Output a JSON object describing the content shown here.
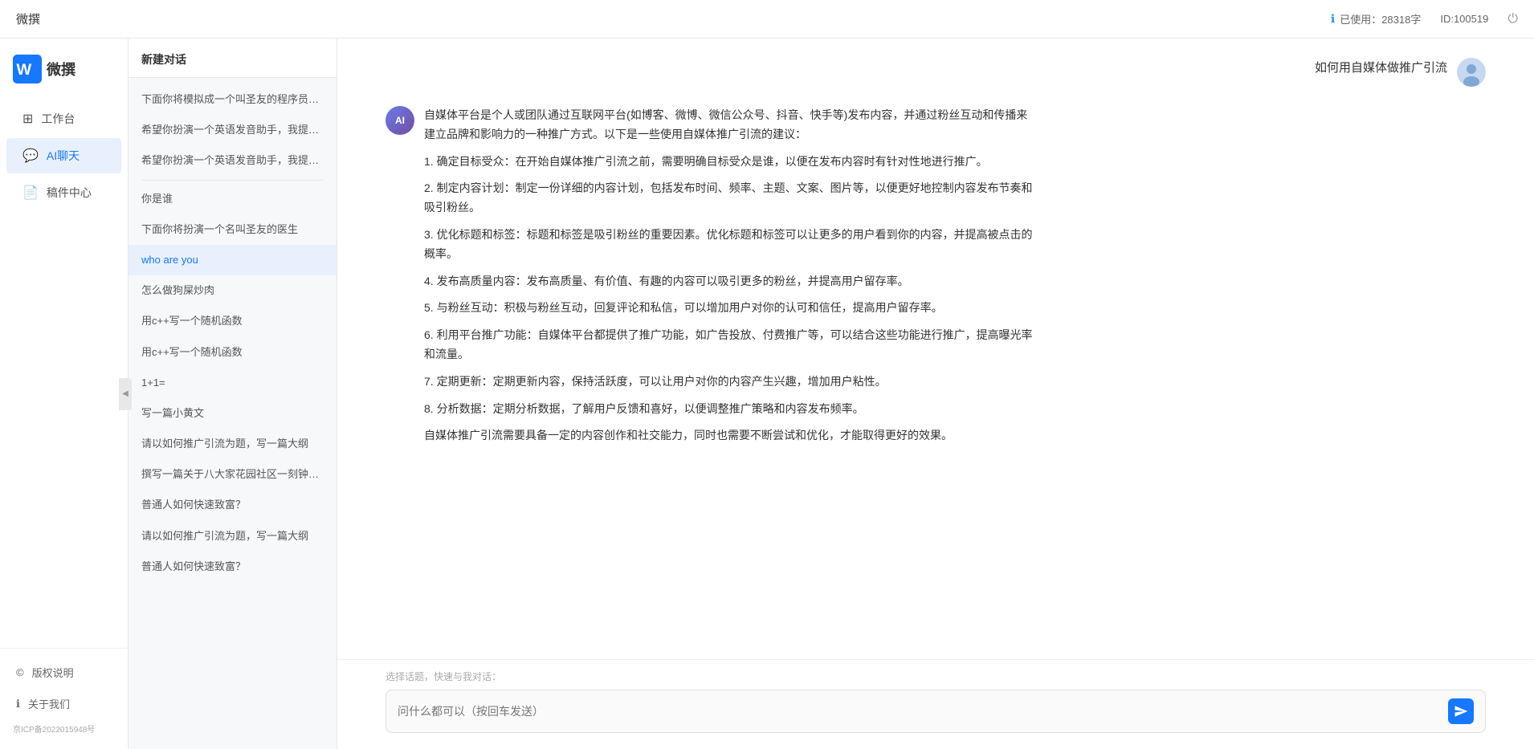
{
  "topbar": {
    "title": "微撰",
    "usage_label": "已使用：28318字",
    "id_label": "ID:100519",
    "usage_icon": "ℹ"
  },
  "sidebar": {
    "logo_text": "微撰",
    "nav_items": [
      {
        "id": "workbench",
        "label": "工作台",
        "icon": "⊞"
      },
      {
        "id": "aichat",
        "label": "AI聊天",
        "icon": "💬",
        "active": true
      },
      {
        "id": "drafts",
        "label": "稿件中心",
        "icon": "📄"
      }
    ],
    "bottom_items": [
      {
        "id": "copyright",
        "label": "版权说明",
        "icon": "©"
      },
      {
        "id": "about",
        "label": "关于我们",
        "icon": "ℹ"
      }
    ],
    "icp": "京ICP备2022015948号"
  },
  "history": {
    "new_chat_label": "新建对话",
    "items": [
      {
        "id": 1,
        "text": "下面你将模拟成一个叫圣友的程序员，我说...",
        "active": false
      },
      {
        "id": 2,
        "text": "希望你扮演一个英语发音助手，我提供给你...",
        "active": false
      },
      {
        "id": 3,
        "text": "希望你扮演一个英语发音助手，我提供给你...",
        "active": false
      },
      {
        "id": 4,
        "text": "你是谁",
        "active": false
      },
      {
        "id": 5,
        "text": "下面你将扮演一个名叫圣友的医生",
        "active": false
      },
      {
        "id": 6,
        "text": "who are you",
        "active": true
      },
      {
        "id": 7,
        "text": "怎么做狗屎炒肉",
        "active": false
      },
      {
        "id": 8,
        "text": "用c++写一个随机函数",
        "active": false
      },
      {
        "id": 9,
        "text": "用c++写一个随机函数",
        "active": false
      },
      {
        "id": 10,
        "text": "1+1=",
        "active": false
      },
      {
        "id": 11,
        "text": "写一篇小黄文",
        "active": false
      },
      {
        "id": 12,
        "text": "请以如何推广引流为题，写一篇大纲",
        "active": false
      },
      {
        "id": 13,
        "text": "撰写一篇关于八大家花园社区一刻钟便民生...",
        "active": false
      },
      {
        "id": 14,
        "text": "普通人如何快速致富？",
        "active": false
      },
      {
        "id": 15,
        "text": "请以如何推广引流为题，写一篇大纲",
        "active": false
      },
      {
        "id": 16,
        "text": "普通人如何快速致富？",
        "active": false
      }
    ]
  },
  "chat": {
    "messages": [
      {
        "id": 1,
        "role": "user",
        "text": "如何用自媒体做推广引流"
      },
      {
        "id": 2,
        "role": "ai",
        "paragraphs": [
          "自媒体平台是个人或团队通过互联网平台(如博客、微博、微信公众号、抖音、快手等)发布内容，并通过粉丝互动和传播来建立品牌和影响力的一种推广方式。以下是一些使用自媒体推广引流的建议：",
          "1. 确定目标受众：在开始自媒体推广引流之前，需要明确目标受众是谁，以便在发布内容时有针对性地进行推广。",
          "2. 制定内容计划：制定一份详细的内容计划，包括发布时间、频率、主题、文案、图片等，以便更好地控制内容发布节奏和吸引粉丝。",
          "3. 优化标题和标签：标题和标签是吸引粉丝的重要因素。优化标题和标签可以让更多的用户看到你的内容，并提高被点击的概率。",
          "4. 发布高质量内容：发布高质量、有价值、有趣的内容可以吸引更多的粉丝，并提高用户留存率。",
          "5. 与粉丝互动：积极与粉丝互动，回复评论和私信，可以增加用户对你的认可和信任，提高用户留存率。",
          "6. 利用平台推广功能：自媒体平台都提供了推广功能，如广告投放、付费推广等，可以结合这些功能进行推广，提高曝光率和流量。",
          "7. 定期更新：定期更新内容，保持活跃度，可以让用户对你的内容产生兴趣，增加用户粘性。",
          "8. 分析数据：定期分析数据，了解用户反馈和喜好，以便调整推广策略和内容发布频率。",
          "自媒体推广引流需要具备一定的内容创作和社交能力，同时也需要不断尝试和优化，才能取得更好的效果。"
        ]
      }
    ],
    "input_placeholder": "问什么都可以（按回车发送）",
    "quick_topics_label": "选择话题，快速与我对话："
  }
}
